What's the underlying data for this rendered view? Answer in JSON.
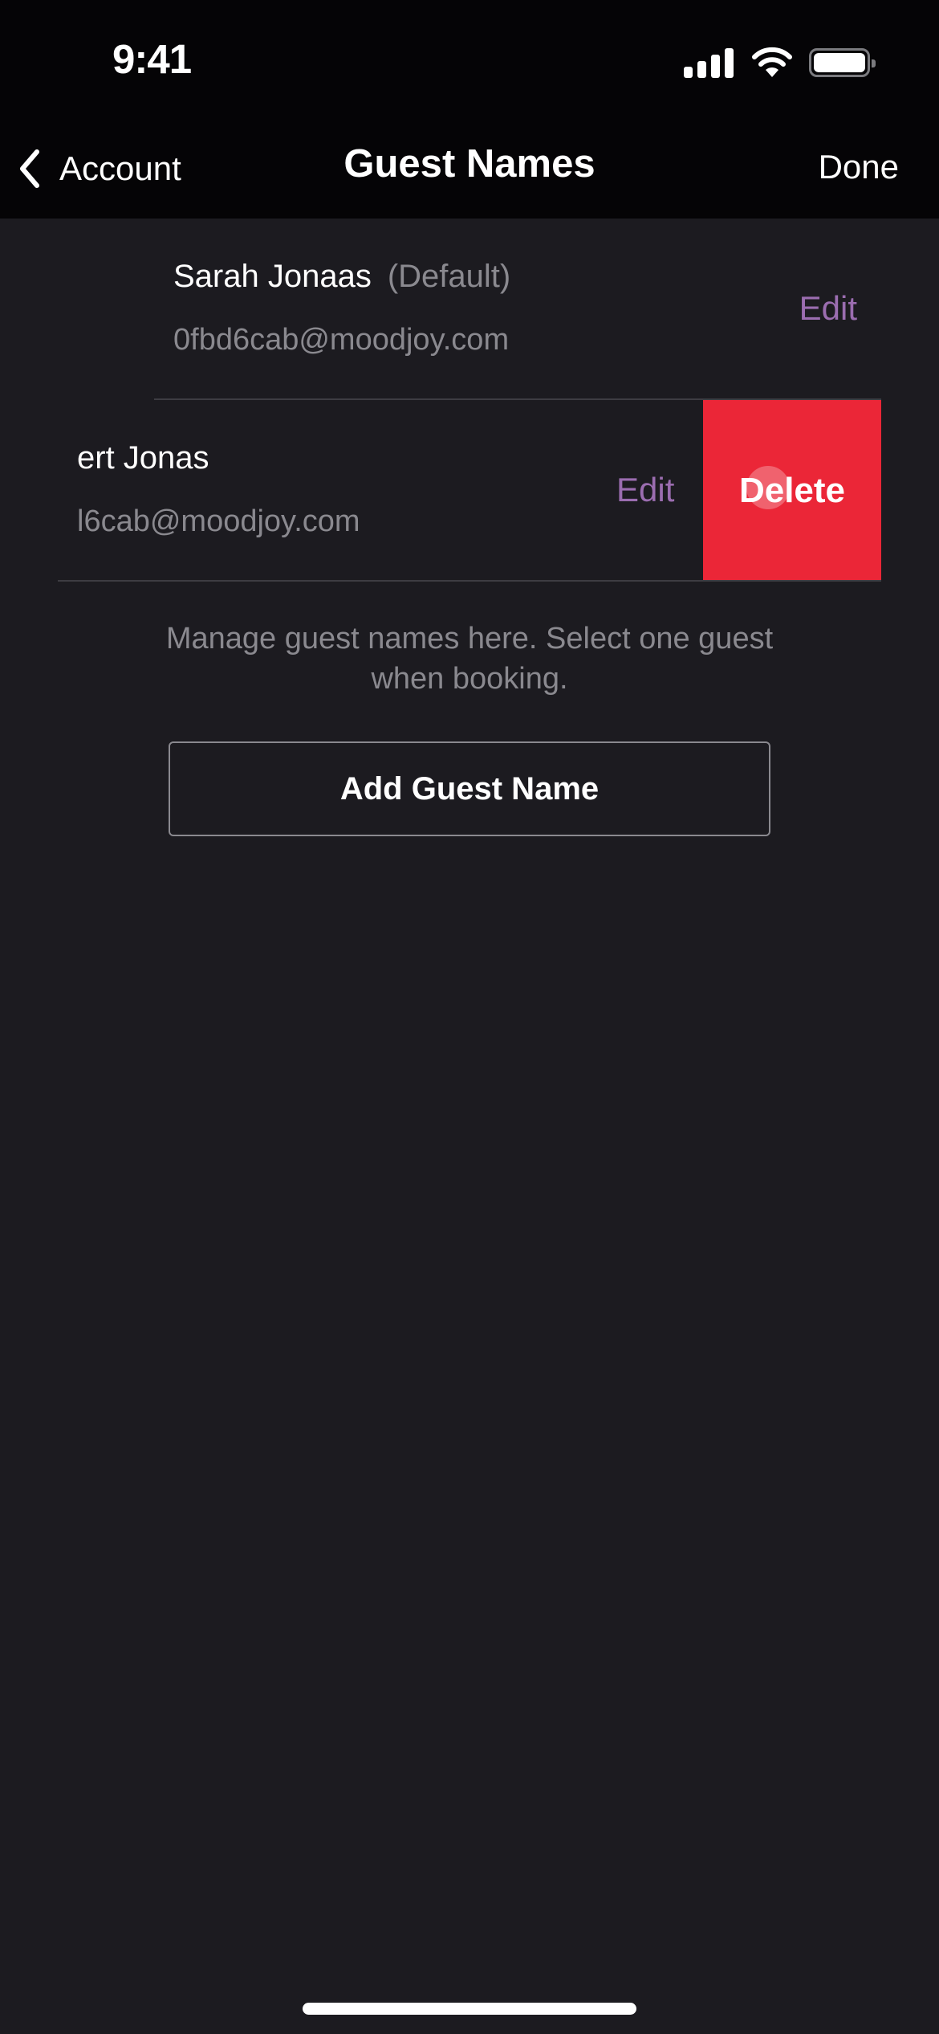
{
  "status_bar": {
    "time": "9:41",
    "icons": [
      "cellular-signal-icon",
      "wifi-icon",
      "battery-icon"
    ]
  },
  "nav": {
    "back_label": "Account",
    "back_icon": "chevron-left-icon",
    "title": "Guest Names",
    "done_label": "Done"
  },
  "guests": [
    {
      "name": "Sarah Jonaas",
      "tag": "(Default)",
      "email": "0fbd6cab@moodjoy.com",
      "edit_label": "Edit"
    },
    {
      "name": "ert Jonas",
      "email": "l6cab@moodjoy.com",
      "edit_label": "Edit",
      "delete_label": "Delete",
      "swiped": true
    }
  ],
  "helper_text": "Manage guest names here. Select one guest when booking.",
  "add_button_label": "Add Guest Name",
  "colors": {
    "background": "#1c1b20",
    "header": "#050406",
    "edit_accent": "#9b6db0",
    "delete_red": "#eb2637",
    "secondary_text": "#8a898f"
  }
}
